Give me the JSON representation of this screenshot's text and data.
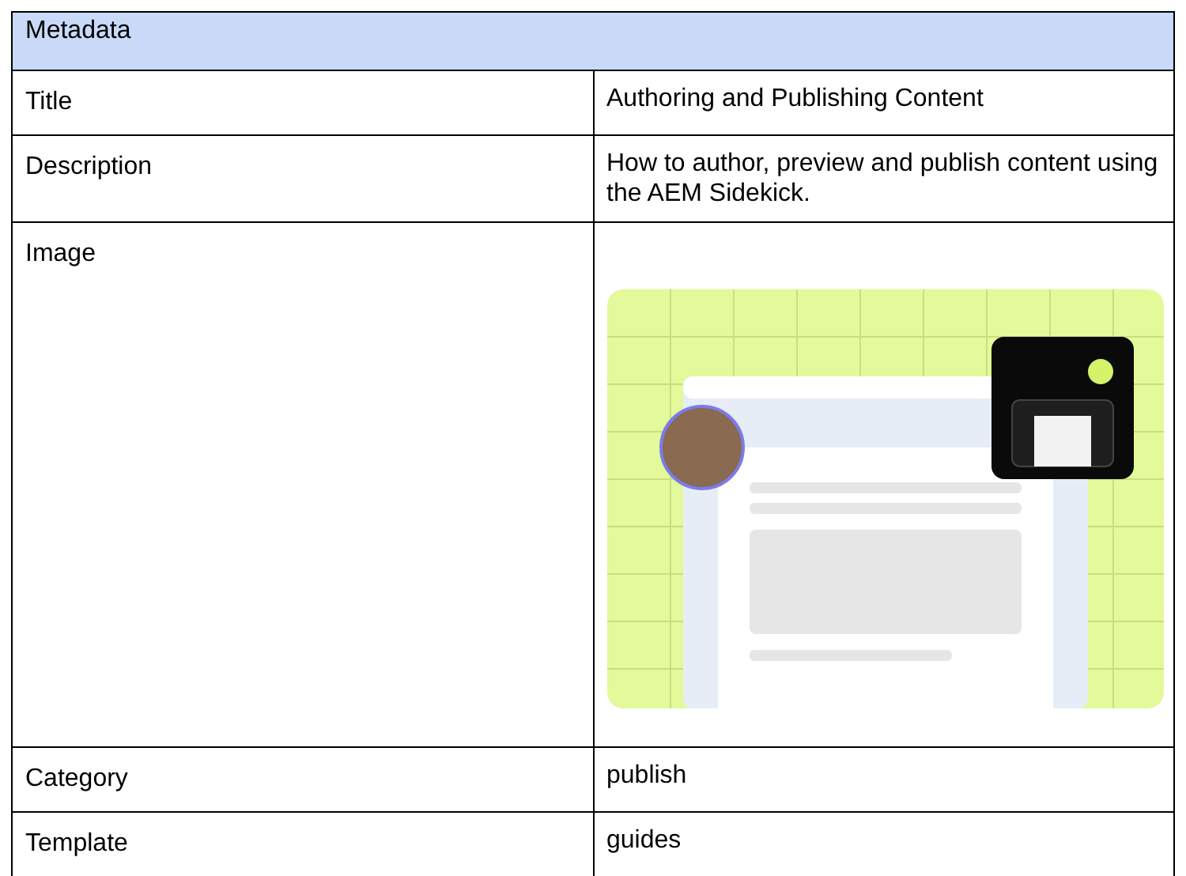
{
  "header": "Metadata",
  "rows": [
    {
      "label": "Title",
      "kind": "text",
      "value": "Authoring and Publishing Content"
    },
    {
      "label": "Description",
      "kind": "text",
      "value": "How to author, preview and publish content using the AEM Sidekick."
    },
    {
      "label": "Image",
      "kind": "picture"
    },
    {
      "label": "Category",
      "kind": "text",
      "value": "publish"
    },
    {
      "label": "Template",
      "kind": "text",
      "value": "guides"
    }
  ]
}
